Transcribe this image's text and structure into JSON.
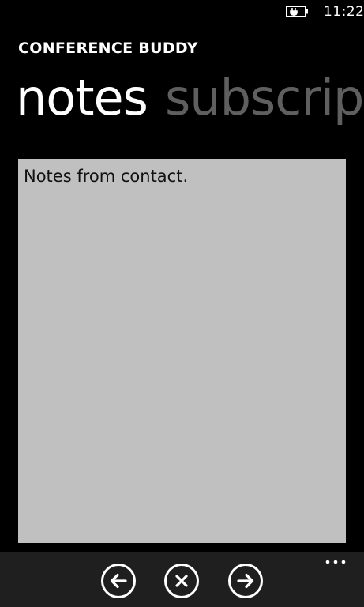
{
  "status_bar": {
    "time": "11:22",
    "battery_icon": "battery-charging-icon"
  },
  "app": {
    "title": "CONFERENCE BUDDY"
  },
  "pivot": {
    "items": [
      {
        "label": "notes",
        "active": true
      },
      {
        "label": "subscript",
        "active": false
      }
    ]
  },
  "notes": {
    "text": "Notes from contact."
  },
  "app_bar": {
    "buttons": [
      {
        "icon": "back-arrow-icon"
      },
      {
        "icon": "close-icon"
      },
      {
        "icon": "forward-arrow-icon"
      }
    ],
    "more_icon": "ellipsis-icon"
  },
  "colors": {
    "background": "#000000",
    "inactive_pivot": "#5f5f5f",
    "notes_background": "#c0c0c0",
    "app_bar": "#1f1f1f"
  }
}
